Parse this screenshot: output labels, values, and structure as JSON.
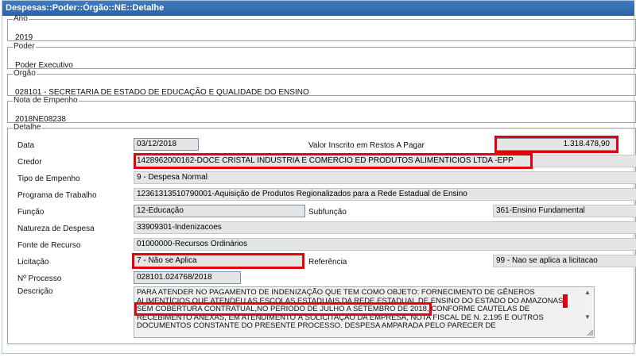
{
  "window": {
    "title": "Despesas::Poder::Órgão::NE::Detalhe"
  },
  "ano": {
    "legend": "Ano",
    "value": "2019"
  },
  "poder": {
    "legend": "Poder",
    "value": "Poder Executivo"
  },
  "orgao": {
    "legend": "Órgão",
    "value": "028101 - SECRETARIA DE ESTADO DE EDUCAÇÃO E QUALIDADE DO ENSINO"
  },
  "nota": {
    "legend": "Nota de Empenho",
    "value": "2018NE08238"
  },
  "detalhe": {
    "legend": "Detalhe",
    "data_label": "Data",
    "data_value": "03/12/2018",
    "valor_inscrito_label": "Valor Inscrito em Restos A Pagar",
    "valor_inscrito_value": "1.318.478,90",
    "credor_label": "Credor",
    "credor_value": "1428962000162-DOCE CRISTAL INDUSTRIA E COMERCIO ED PRODUTOS ALIMENTICIOS LTDA -EPP",
    "tipo_label": "Tipo de Empenho",
    "tipo_value": "9 - Despesa Normal",
    "programa_label": "Programa de Trabalho",
    "programa_value": "12361313510790001-Aquisição de Produtos Regionalizados para a Rede Estadual de Ensino",
    "funcao_label": "Função",
    "funcao_value": "12-Educação",
    "subfuncao_label": "Subfunção",
    "subfuncao_value": "361-Ensino Fundamental",
    "natureza_label": "Natureza de Despesa",
    "natureza_value": "33909301-Indenizacoes",
    "fonte_label": "Fonte de Recurso",
    "fonte_value": "01000000-Recursos Ordinários",
    "licitacao_label": "Licitação",
    "licitacao_value": "7 - Não se Aplica",
    "referencia_label": "Referência",
    "referencia_value": "99 - Nao se aplica a licitacao",
    "processo_label": "Nº Processo",
    "processo_value": "028101.024768/2018",
    "descricao_label": "Descrição",
    "descricao_part1": "PARA ATENDER NO PAGAMENTO DE INDENIZAÇÃO QUE TEM COMO OBJETO: FORNECIMENTO DE GÊNEROS ALIMENTÍCIOS QUE ATENDEU AS ESCOLAS ESTADUAIS DA REDE ESTADUAL DE ENSINO DO ESTADO DO AMAZONAS,",
    "descricao_highlight": " SEM COBERTURA CONTRATUAL,NO PERIODO DE JULHO A SETEMBRO DE 2018,",
    "descricao_part2": " CONFORME CAUTELAS DE RECEBIMENTO ANEXAS, EM ATENDIMENTO À SOLICITAÇÃO DA EMPRESA, NOTA FISCAL DE N. 2.195 E OUTROS DOCUMENTOS CONSTANTE DO PRESENTE PROCESSO. DESPESA AMPARADA PELO PARECER DE"
  },
  "colors": {
    "title_bar": "#2d63a6",
    "highlight": "#e3000f",
    "field_bg": "#e5e5e5"
  }
}
